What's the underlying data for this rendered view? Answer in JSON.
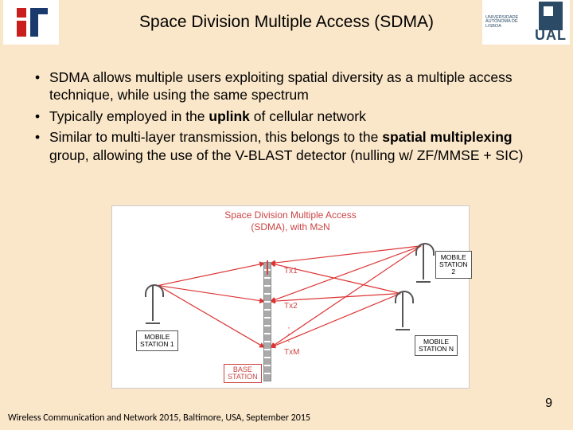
{
  "title": "Space Division Multiple Access (SDMA)",
  "bullets": {
    "b1a": "SDMA allows multiple users exploiting spatial diversity as a multiple access technique, while using the same spectrum",
    "b2a": "Typically employed in the ",
    "b2b": "uplink",
    "b2c": " of cellular network",
    "b3a": "Similar to multi-layer transmission, this belongs to the ",
    "b3b": "spatial multiplexing",
    "b3c": " group, allowing the use of the V-BLAST detector (nulling w/ ZF/MMSE + SIC)"
  },
  "diagram": {
    "title1": "Space Division Multiple Access",
    "title2": "(SDMA), with M≥N",
    "tx1": "Tx1",
    "tx2": "Tx2",
    "txm": "TxM",
    "ms1a": "MOBILE",
    "ms1b": "STATION 1",
    "ms2a": "MOBILE",
    "ms2b": "STATION 2",
    "msna": "MOBILE",
    "msnb": "STATION N",
    "bsa": "BASE",
    "bsb": "STATION"
  },
  "pageNumber": "9",
  "footer": "Wireless Communication and Network 2015, Baltimore, USA, September 2015",
  "ual": {
    "small": "UNIVERSIDADE AUTÓNOMA DE LISBOA",
    "big": "UAL"
  }
}
